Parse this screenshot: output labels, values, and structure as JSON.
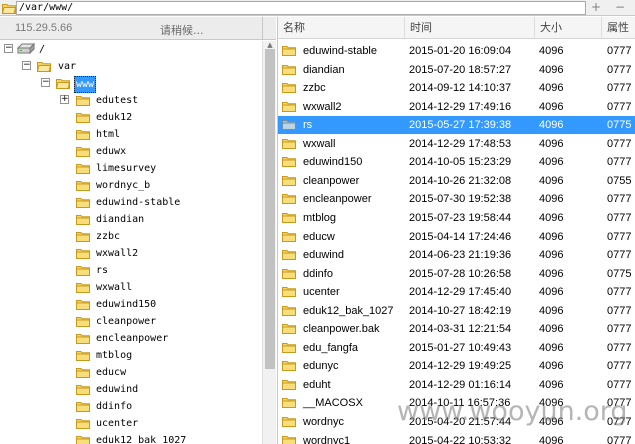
{
  "path_bar": {
    "path": "/var/www/",
    "add_label": "+",
    "remove_label": "−"
  },
  "left_header": {
    "server_ip": "115.29.5.66",
    "status": "请稍候..."
  },
  "tree": {
    "root": "/",
    "var": "var",
    "www": "www",
    "children": [
      "edutest",
      "eduk12",
      "html",
      "eduwx",
      "limesurvey",
      "wordnyc_b",
      "eduwind-stable",
      "diandian",
      "zzbc",
      "wxwall2",
      "rs",
      "wxwall",
      "eduwind150",
      "cleanpower",
      "encleanpower",
      "mtblog",
      "educw",
      "eduwind",
      "ddinfo",
      "ucenter",
      "eduk12_bak_1027"
    ]
  },
  "list_header": {
    "name": "名称",
    "time": "时间",
    "size": "大小",
    "attr": "属性"
  },
  "files": [
    {
      "name": "eduwind-stable",
      "time": "2015-01-20 16:09:04",
      "size": "4096",
      "attr": "0777"
    },
    {
      "name": "diandian",
      "time": "2015-07-20 18:57:27",
      "size": "4096",
      "attr": "0777"
    },
    {
      "name": "zzbc",
      "time": "2014-09-12 14:10:37",
      "size": "4096",
      "attr": "0777"
    },
    {
      "name": "wxwall2",
      "time": "2014-12-29 17:49:16",
      "size": "4096",
      "attr": "0777"
    },
    {
      "name": "rs",
      "time": "2015-05-27 17:39:38",
      "size": "4096",
      "attr": "0775"
    },
    {
      "name": "wxwall",
      "time": "2014-12-29 17:48:53",
      "size": "4096",
      "attr": "0777"
    },
    {
      "name": "eduwind150",
      "time": "2014-10-05 15:23:29",
      "size": "4096",
      "attr": "0777"
    },
    {
      "name": "cleanpower",
      "time": "2014-10-26 21:32:08",
      "size": "4096",
      "attr": "0755"
    },
    {
      "name": "encleanpower",
      "time": "2015-07-30 19:52:38",
      "size": "4096",
      "attr": "0777"
    },
    {
      "name": "mtblog",
      "time": "2015-07-23 19:58:44",
      "size": "4096",
      "attr": "0777"
    },
    {
      "name": "educw",
      "time": "2015-04-14 17:24:46",
      "size": "4096",
      "attr": "0777"
    },
    {
      "name": "eduwind",
      "time": "2014-06-23 21:19:36",
      "size": "4096",
      "attr": "0777"
    },
    {
      "name": "ddinfo",
      "time": "2015-07-28 10:26:58",
      "size": "4096",
      "attr": "0775"
    },
    {
      "name": "ucenter",
      "time": "2014-12-29 17:45:40",
      "size": "4096",
      "attr": "0777"
    },
    {
      "name": "eduk12_bak_1027",
      "time": "2014-10-27 18:42:19",
      "size": "4096",
      "attr": "0777"
    },
    {
      "name": "cleanpower.bak",
      "time": "2014-03-31 12:21:54",
      "size": "4096",
      "attr": "0777"
    },
    {
      "name": "edu_fangfa",
      "time": "2015-01-27 10:49:43",
      "size": "4096",
      "attr": "0777"
    },
    {
      "name": "edunyc",
      "time": "2014-12-29 19:49:25",
      "size": "4096",
      "attr": "0777"
    },
    {
      "name": "eduht",
      "time": "2014-12-29 01:16:14",
      "size": "4096",
      "attr": "0777"
    },
    {
      "name": "__MACOSX",
      "time": "2014-10-11 16:57:36",
      "size": "4096",
      "attr": "0777"
    },
    {
      "name": "wordnyc",
      "time": "2015-04-20 21:57:44",
      "size": "4096",
      "attr": "0777"
    },
    {
      "name": "wordnyc1",
      "time": "2015-04-22 10:53:32",
      "size": "4096",
      "attr": "0777"
    }
  ],
  "selected_file": "rs",
  "watermark": "www.wooyun.org",
  "colors": {
    "selection": "#3399ff",
    "folder": "#f2cf52"
  }
}
